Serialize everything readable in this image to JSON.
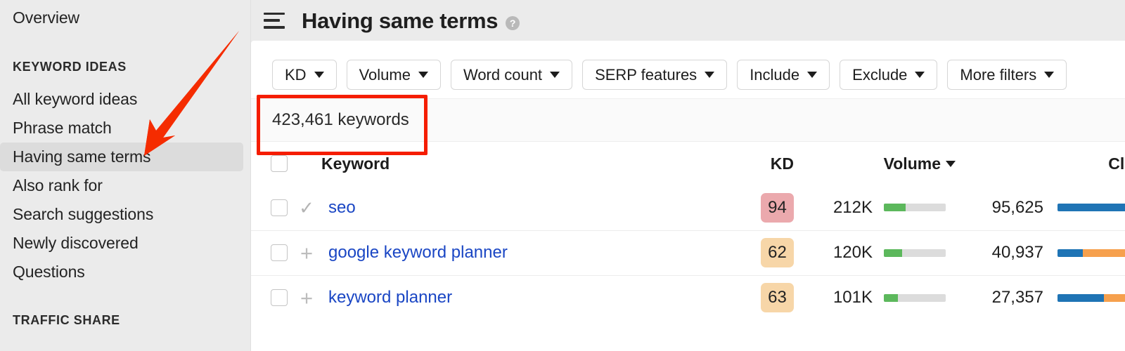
{
  "sidebar": {
    "overview_label": "Overview",
    "sections": [
      {
        "title": "KEYWORD IDEAS",
        "items": [
          {
            "label": "All keyword ideas",
            "active": false
          },
          {
            "label": "Phrase match",
            "active": false
          },
          {
            "label": "Having same terms",
            "active": true
          },
          {
            "label": "Also rank for",
            "active": false
          },
          {
            "label": "Search suggestions",
            "active": false
          },
          {
            "label": "Newly discovered",
            "active": false
          },
          {
            "label": "Questions",
            "active": false
          }
        ]
      },
      {
        "title": "TRAFFIC SHARE",
        "items": []
      }
    ]
  },
  "header": {
    "menu_icon": "hamburger-icon",
    "title": "Having same terms",
    "help_icon": "?"
  },
  "filters": [
    {
      "label": "KD",
      "icon": "chevron-down-icon"
    },
    {
      "label": "Volume",
      "icon": "chevron-down-icon"
    },
    {
      "label": "Word count",
      "icon": "chevron-down-icon"
    },
    {
      "label": "SERP features",
      "icon": "chevron-down-icon"
    },
    {
      "label": "Include",
      "icon": "chevron-down-icon"
    },
    {
      "label": "Exclude",
      "icon": "chevron-down-icon"
    },
    {
      "label": "More filters",
      "icon": "chevron-down-icon"
    }
  ],
  "results": {
    "count_text": "423,461 keywords",
    "highlight_color": "#f51d00"
  },
  "table": {
    "columns": {
      "keyword": "Keyword",
      "kd": "KD",
      "volume": "Volume",
      "clicks": "Clicks"
    },
    "sorted_by": "Volume",
    "sort_direction": "desc",
    "rows": [
      {
        "add_icon": "check-icon",
        "keyword": "seo",
        "kd": "94",
        "kd_color": "#eba9ad",
        "volume": "212K",
        "volume_bar_pct": 35,
        "clicks": "95,625",
        "clicks_blue_pct": 92,
        "clicks_orange_pct": 8
      },
      {
        "add_icon": "plus-icon",
        "keyword": "google keyword planner",
        "kd": "62",
        "kd_color": "#f7d6a8",
        "volume": "120K",
        "volume_bar_pct": 29,
        "clicks": "40,937",
        "clicks_blue_pct": 30,
        "clicks_orange_pct": 70
      },
      {
        "add_icon": "plus-icon",
        "keyword": "keyword planner",
        "kd": "63",
        "kd_color": "#f7d6a8",
        "volume": "101K",
        "volume_bar_pct": 23,
        "clicks": "27,357",
        "clicks_blue_pct": 55,
        "clicks_orange_pct": 45
      }
    ]
  },
  "colors": {
    "volume_bar": "#5cb85c",
    "volume_track": "#dcdcdc",
    "clicks_blue": "#1f74b5",
    "clicks_orange": "#f5a council",
    "clicks_orange_hex": "#f7a košt"
  },
  "bar_colors": {
    "green": "#5cb85c",
    "track": "#dcdcdc",
    "blue": "#1f74b5",
    "orange": "#f6a04d"
  },
  "annotation": {
    "arrow_color": "#f52c00",
    "points_to": "Having same terms"
  }
}
